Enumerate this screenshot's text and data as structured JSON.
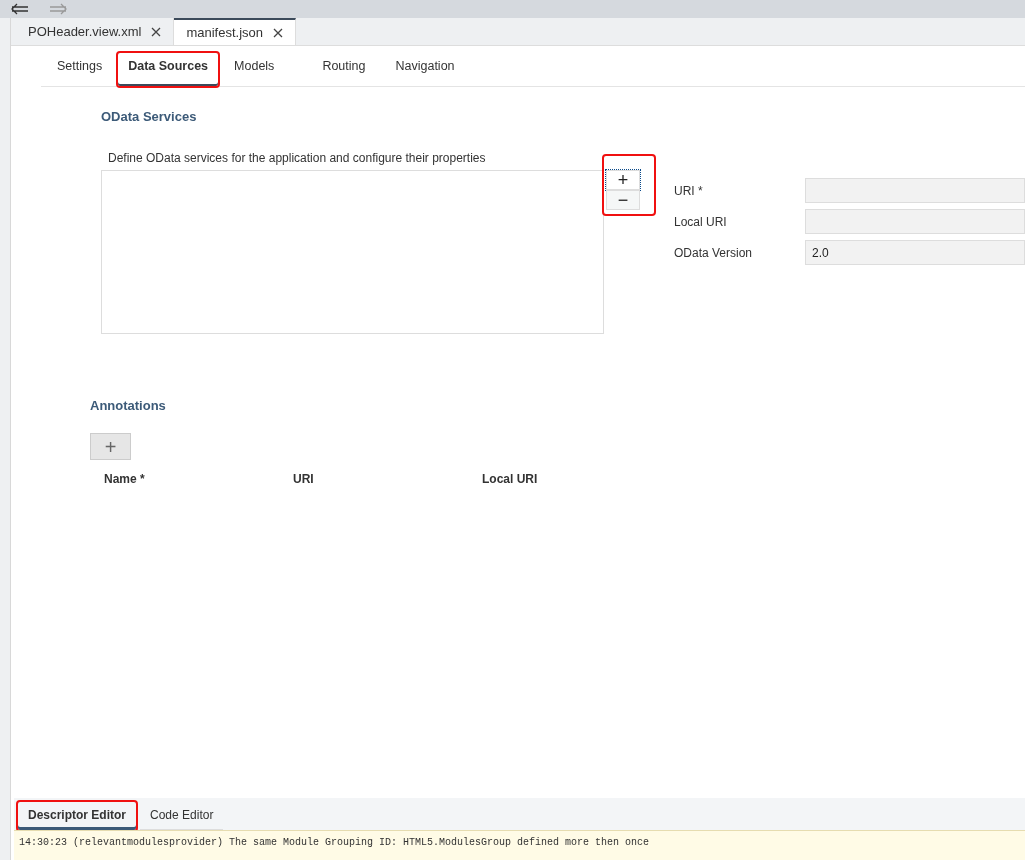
{
  "file_tabs": [
    {
      "label": "POHeader.view.xml",
      "selected": false
    },
    {
      "label": "manifest.json",
      "selected": true
    }
  ],
  "section_tabs": [
    {
      "label": "Settings",
      "selected": false,
      "highlighted": false
    },
    {
      "label": "Data Sources",
      "selected": true,
      "highlighted": true
    },
    {
      "label": "Models",
      "selected": false,
      "highlighted": false
    },
    {
      "label": "Routing",
      "selected": false,
      "highlighted": false
    },
    {
      "label": "Navigation",
      "selected": false,
      "highlighted": false
    }
  ],
  "odata_services": {
    "title": "OData Services",
    "description": "Define OData services for the application and configure their properties",
    "add_button": {
      "label": "+",
      "highlighted": true
    },
    "remove_button": {
      "label": "−"
    },
    "fields": [
      {
        "label": "URI *"
      },
      {
        "label": "Local URI"
      },
      {
        "label": "OData Version",
        "value": "2.0"
      }
    ]
  },
  "annotations": {
    "title": "Annotations",
    "add_button": {
      "label": "+"
    },
    "columns": [
      "Name *",
      "URI",
      "Local URI"
    ]
  },
  "editor_tabs": [
    {
      "label": "Descriptor Editor",
      "selected": true,
      "highlighted": true
    },
    {
      "label": "Code Editor",
      "selected": false,
      "highlighted": false
    }
  ],
  "console": [
    "14:30:23 (relevantmodulesprovider) The same Module Grouping ID: HTML5.ModulesGroup defined more then once"
  ]
}
